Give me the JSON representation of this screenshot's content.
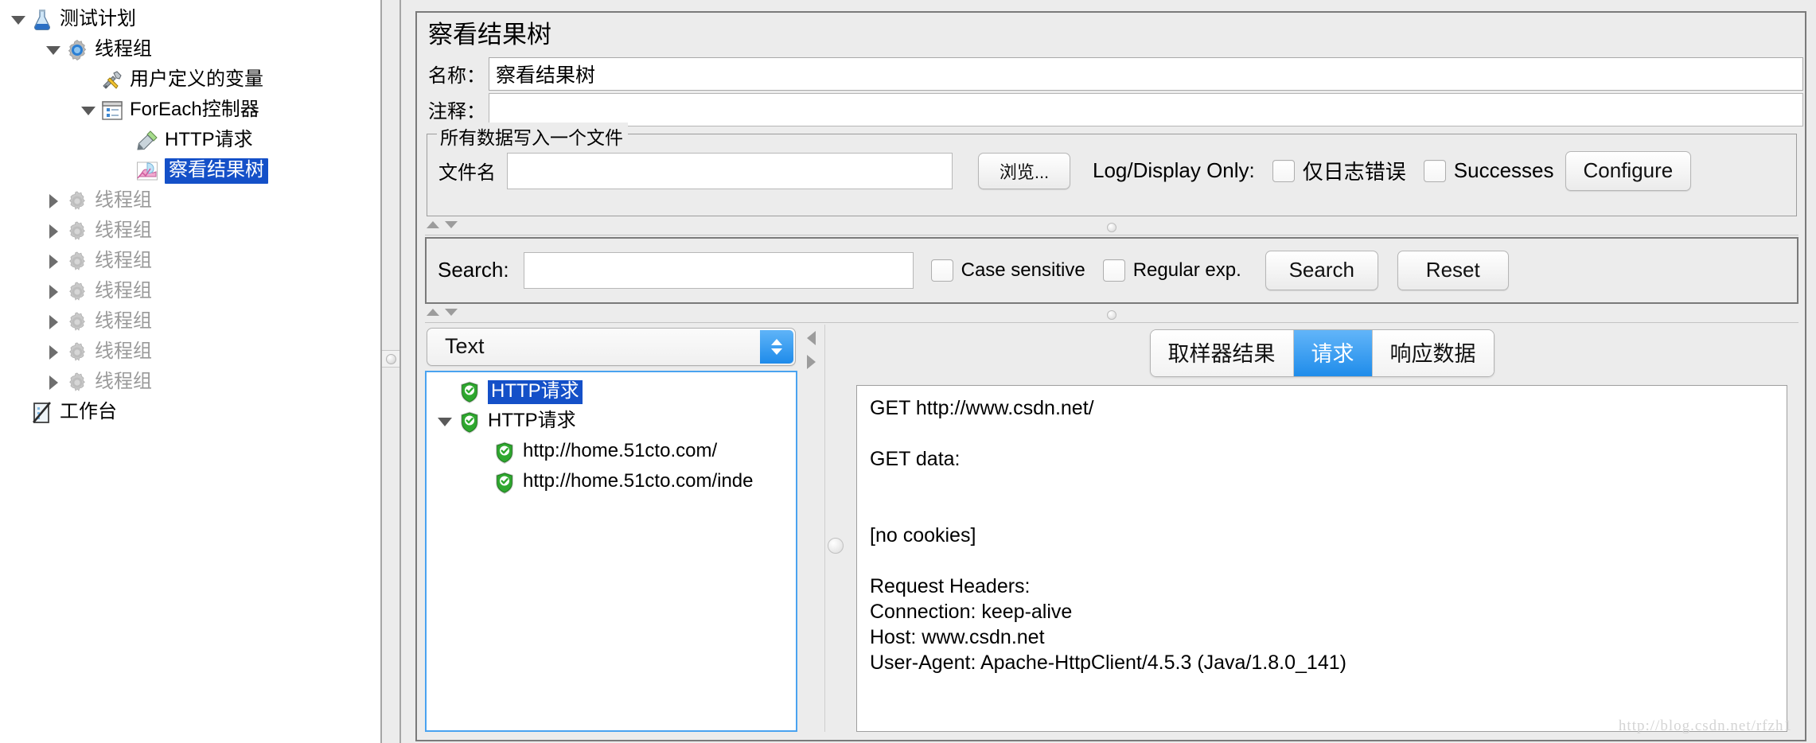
{
  "tree": {
    "nodes": [
      {
        "label": "测试计划",
        "depth": 0,
        "toggle": "down",
        "icon": "flask-icon",
        "state": "normal"
      },
      {
        "label": "线程组",
        "depth": 1,
        "toggle": "down",
        "icon": "gear-blue-icon",
        "state": "normal"
      },
      {
        "label": "用户定义的变量",
        "depth": 2,
        "toggle": "none",
        "icon": "tools-icon",
        "state": "normal"
      },
      {
        "label": "ForEach控制器",
        "depth": 2,
        "toggle": "down",
        "icon": "foreach-controller-icon",
        "state": "normal"
      },
      {
        "label": "HTTP请求",
        "depth": 3,
        "toggle": "none",
        "icon": "http-request-icon",
        "state": "normal"
      },
      {
        "label": "察看结果树",
        "depth": 3,
        "toggle": "none",
        "icon": "view-results-tree-icon",
        "state": "selected"
      },
      {
        "label": "线程组",
        "depth": 1,
        "toggle": "right",
        "icon": "gear-gray-icon",
        "state": "disabled"
      },
      {
        "label": "线程组",
        "depth": 1,
        "toggle": "right",
        "icon": "gear-gray-icon",
        "state": "disabled"
      },
      {
        "label": "线程组",
        "depth": 1,
        "toggle": "right",
        "icon": "gear-gray-icon",
        "state": "disabled"
      },
      {
        "label": "线程组",
        "depth": 1,
        "toggle": "right",
        "icon": "gear-gray-icon",
        "state": "disabled"
      },
      {
        "label": "线程组",
        "depth": 1,
        "toggle": "right",
        "icon": "gear-gray-icon",
        "state": "disabled"
      },
      {
        "label": "线程组",
        "depth": 1,
        "toggle": "right",
        "icon": "gear-gray-icon",
        "state": "disabled"
      },
      {
        "label": "线程组",
        "depth": 1,
        "toggle": "right",
        "icon": "gear-gray-icon",
        "state": "disabled"
      },
      {
        "label": "工作台",
        "depth": 0,
        "toggle": "none",
        "icon": "workbench-icon",
        "state": "normal"
      }
    ]
  },
  "panel": {
    "title": "察看结果树",
    "name_label": "名称：",
    "name_value": "察看结果树",
    "comment_label": "注释：",
    "comment_value": "",
    "filegroup": {
      "legend": "所有数据写入一个文件",
      "filename_label": "文件名",
      "filename_value": "",
      "filename_placeholder": "",
      "browse_label": "浏览...",
      "log_display_label": "Log/Display Only:",
      "errors_label": "仅日志错误",
      "errors_checked": false,
      "successes_label": "Successes",
      "successes_checked": false,
      "configure_label": "Configure"
    },
    "search": {
      "label": "Search:",
      "value": "",
      "placeholder": "",
      "case_sensitive_label": "Case sensitive",
      "case_sensitive_checked": false,
      "regular_exp_label": "Regular exp.",
      "regular_exp_checked": false,
      "search_button": "Search",
      "reset_button": "Reset"
    },
    "renderer": {
      "selected": "Text"
    },
    "result_tree": [
      {
        "label": "HTTP请求",
        "depth": 0,
        "toggle": "none",
        "status": "success",
        "selected": true
      },
      {
        "label": "HTTP请求",
        "depth": 0,
        "toggle": "down",
        "status": "success",
        "selected": false
      },
      {
        "label": "http://home.51cto.com/",
        "depth": 1,
        "toggle": "none",
        "status": "success",
        "selected": false
      },
      {
        "label": "http://home.51cto.com/inde",
        "depth": 1,
        "toggle": "none",
        "status": "success",
        "selected": false
      }
    ],
    "tabs": [
      {
        "label": "取样器结果",
        "active": false
      },
      {
        "label": "请求",
        "active": true
      },
      {
        "label": "响应数据",
        "active": false
      }
    ],
    "request_text": [
      "GET http://www.csdn.net/",
      "",
      "GET data:",
      "",
      "",
      "[no cookies]",
      "",
      "Request Headers:",
      "Connection: keep-alive",
      "Host: www.csdn.net",
      "User-Agent: Apache-HttpClient/4.5.3 (Java/1.8.0_141)"
    ]
  },
  "watermark": "http://blog.csdn.net/rfzh1",
  "colors": {
    "selection_blue": "#1450c8",
    "tab_active_blue": "#1f8cea",
    "tree_border_blue": "#4aa3f0",
    "panel_bg": "#ececec",
    "success_green": "#2fa82f"
  }
}
